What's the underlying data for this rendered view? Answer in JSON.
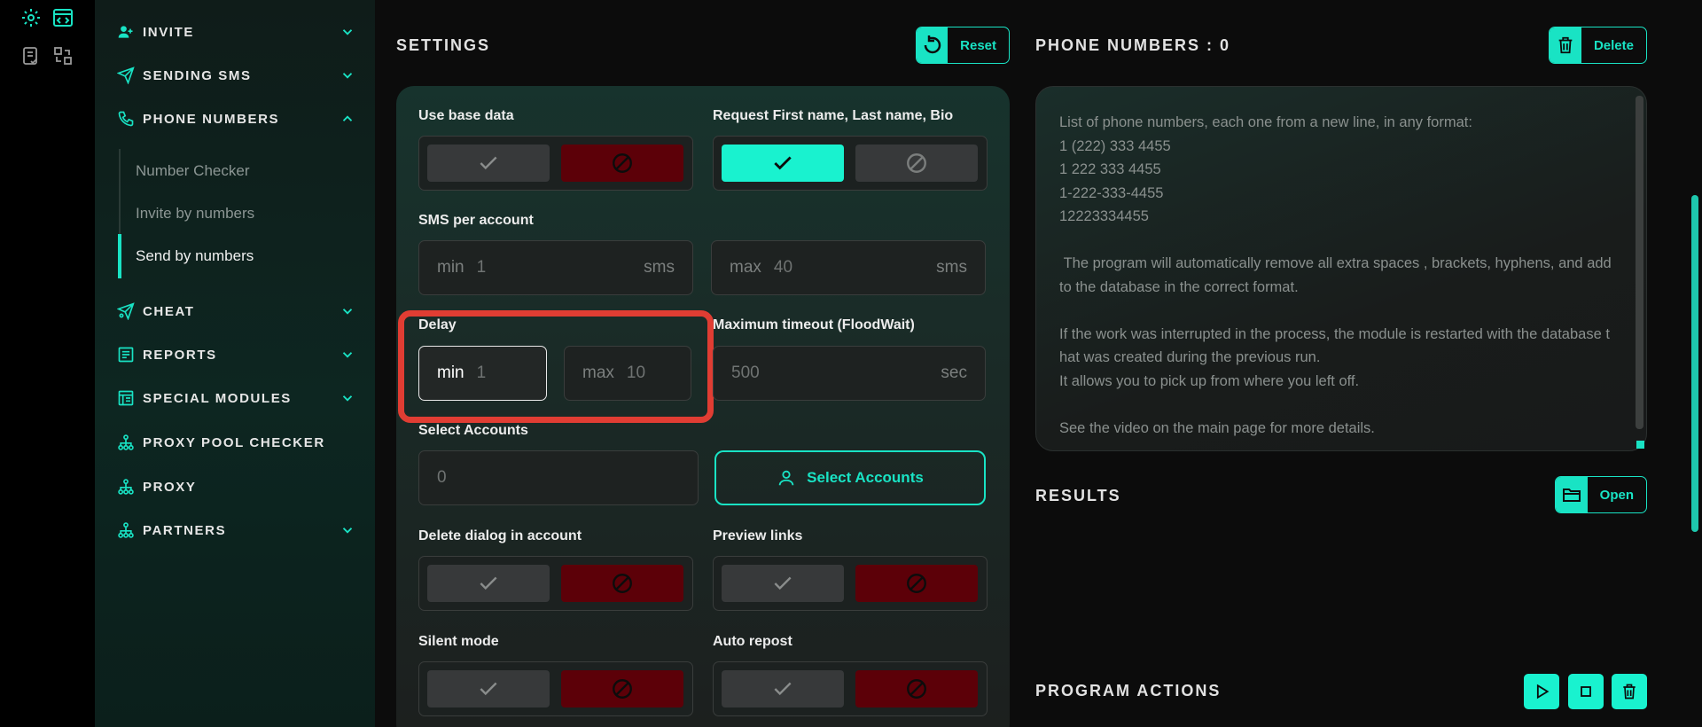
{
  "colors": {
    "accent": "#19e3c4",
    "danger": "#5c0008",
    "highlight": "#e03d33"
  },
  "rail": {
    "icons": [
      "gear-icon",
      "code-window-icon",
      "checklist-icon",
      "swap-icon"
    ]
  },
  "sidebar": {
    "items": [
      {
        "label": "INVITE",
        "icon": "user-plus-icon",
        "chevron": "down"
      },
      {
        "label": "SENDING SMS",
        "icon": "paper-plane-icon",
        "chevron": "down"
      },
      {
        "label": "PHONE NUMBERS",
        "icon": "phone-icon",
        "chevron": "up"
      },
      {
        "label": "CHEAT",
        "icon": "rocket-icon",
        "chevron": "down"
      },
      {
        "label": "REPORTS",
        "icon": "report-icon",
        "chevron": "down"
      },
      {
        "label": "SPECIAL MODULES",
        "icon": "modules-icon",
        "chevron": "down"
      },
      {
        "label": "PROXY POOL CHECKER",
        "icon": "network-icon",
        "chevron": ""
      },
      {
        "label": "PROXY",
        "icon": "network-icon",
        "chevron": ""
      },
      {
        "label": "PARTNERS",
        "icon": "network-icon",
        "chevron": "down"
      }
    ],
    "subitems": [
      "Number Checker",
      "Invite by numbers",
      "Send by numbers"
    ]
  },
  "settings": {
    "title": "SETTINGS",
    "reset_label": "Reset",
    "use_base_data": "Use base data",
    "request_names": "Request First name, Last name, Bio",
    "sms_per_account": "SMS per account",
    "sms_min_prefix": "min",
    "sms_min_value": "1",
    "sms_min_unit": "sms",
    "sms_max_prefix": "max",
    "sms_max_value": "40",
    "sms_max_unit": "sms",
    "delay": "Delay",
    "delay_min_prefix": "min",
    "delay_min_value": "1",
    "delay_max_prefix": "max",
    "delay_max_value": "10",
    "max_timeout": "Maximum timeout (FloodWait)",
    "timeout_value": "500",
    "timeout_unit": "sec",
    "select_accounts": "Select Accounts",
    "accounts_value": "0",
    "select_accounts_button": "Select Accounts",
    "delete_dialog": "Delete dialog in account",
    "preview_links": "Preview links",
    "silent_mode": "Silent mode",
    "auto_repost": "Auto repost"
  },
  "phone": {
    "title": "PHONE NUMBERS : 0",
    "delete_label": "Delete",
    "placeholder": "List of phone numbers, each one from a new line, in any format:\n1 (222) 333 4455\n1 222 333 4455\n1-222-333-4455\n12223334455\n\n The program will automatically remove all extra spaces , brackets, hyphens, and add to the database in the correct format.\n\nIf the work was interrupted in the process, the module is restarted with the database that was created during the previous run.\nIt allows you to pick up from where you left off.\n\nSee the video on the main page for more details."
  },
  "results": {
    "title": "RESULTS",
    "open_label": "Open"
  },
  "program_actions": {
    "title": "PROGRAM ACTIONS",
    "buttons": [
      "play-icon",
      "stop-icon",
      "trash-icon"
    ]
  }
}
